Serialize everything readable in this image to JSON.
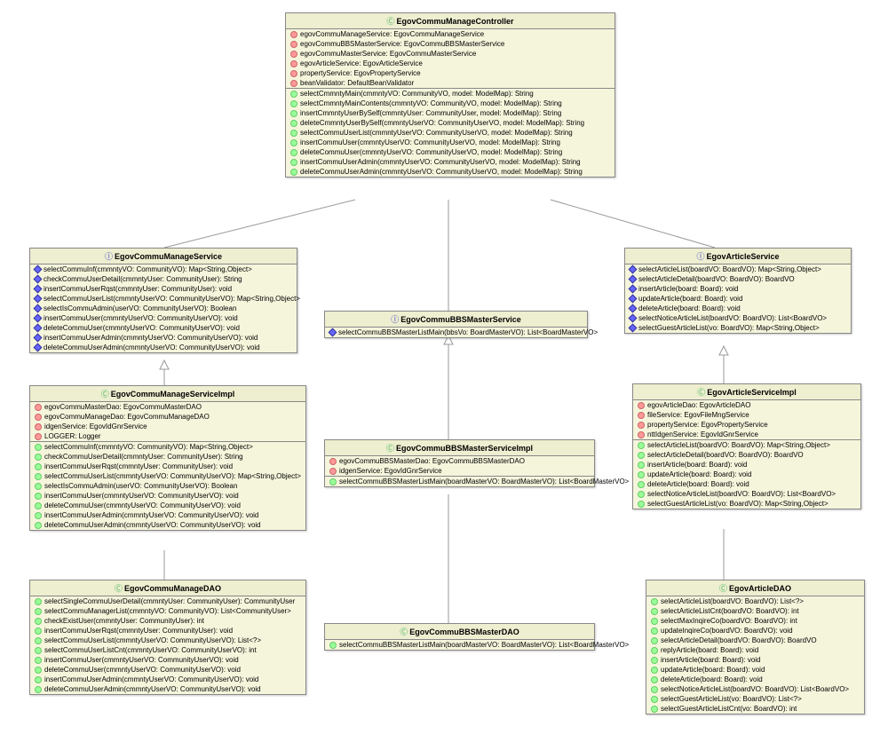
{
  "classes": {
    "controller": {
      "name": "EgovCommuManageController",
      "type": "C",
      "attrs": [
        "egovCommuManageService: EgovCommuManageService",
        "egovCommuBBSMasterService: EgovCommuBBSMasterService",
        "egovCommuMasterService: EgovCommuMasterService",
        "egovArticleService: EgovArticleService",
        "propertyService: EgovPropertyService",
        "beanValidator: DefaultBeanValidator"
      ],
      "methods": [
        "selectCmmntyMain(cmmntyVO: CommunityVO, model: ModelMap): String",
        "selectCmmntyMainContents(cmmntyVO: CommunityVO, model: ModelMap): String",
        "insertCmmntyUserBySelf(cmmntyUser: CommunityUser, model: ModelMap): String",
        "deleteCmmntyUserBySelf(cmmntyUserVO: CommunityUserVO, model: ModelMap): String",
        "selectCommuUserList(cmmntyUserVO: CommunityUserVO, model: ModelMap): String",
        "insertCommuUser(cmmntyUserVO: CommunityUserVO, model: ModelMap): String",
        "deleteCommuUser(cmmntyUserVO: CommunityUserVO, model: ModelMap): String",
        "insertCommuUserAdmin(cmmntyUserVO: CommunityUserVO, model: ModelMap): String",
        "deleteCommuUserAdmin(cmmntyUserVO: CommunityUserVO, model: ModelMap): String"
      ]
    },
    "manageService": {
      "name": "EgovCommuManageService",
      "type": "I",
      "methods": [
        "selectCommuInf(cmmntyVO: CommunityVO): Map<String,Object>",
        "checkCommuUserDetail(cmmntyUser: CommunityUser): String",
        "insertCommuUserRqst(cmmntyUser: CommunityUser): void",
        "selectCommuUserList(cmmntyUserVO: CommunityUserVO): Map<String,Object>",
        "selectIsCommuAdmin(userVO: CommunityUserVO): Boolean",
        "insertCommuUser(cmmntyUserVO: CommunityUserVO): void",
        "deleteCommuUser(cmmntyUserVO: CommunityUserVO): void",
        "insertCommuUserAdmin(cmmntyUserVO: CommunityUserVO): void",
        "deleteCommuUserAdmin(cmmntyUserVO: CommunityUserVO): void"
      ]
    },
    "bbsService": {
      "name": "EgovCommuBBSMasterService",
      "type": "I",
      "methods": [
        "selectCommuBBSMasterListMain(bbsVo: BoardMasterVO): List<BoardMasterVO>"
      ]
    },
    "articleService": {
      "name": "EgovArticleService",
      "type": "I",
      "methods": [
        "selectArticleList(boardVO: BoardVO): Map<String,Object>",
        "selectArticleDetail(boardVO: BoardVO): BoardVO",
        "insertArticle(board: Board): void",
        "updateArticle(board: Board): void",
        "deleteArticle(board: Board): void",
        "selectNoticeArticleList(boardVO: BoardVO): List<BoardVO>",
        "selectGuestArticleList(vo: BoardVO): Map<String,Object>"
      ]
    },
    "manageImpl": {
      "name": "EgovCommuManageServiceImpl",
      "type": "C",
      "attrs": [
        "egovCommuMasterDao: EgovCommuMasterDAO",
        "egovCommuManageDao: EgovCommuManageDAO",
        "idgenService: EgovIdGnrService",
        "LOGGER: Logger"
      ],
      "methods": [
        "selectCommuInf(cmmntyVO: CommunityVO): Map<String,Object>",
        "checkCommuUserDetail(cmmntyUser: CommunityUser): String",
        "insertCommuUserRqst(cmmntyUser: CommunityUser): void",
        "selectCommuUserList(cmmntyUserVO: CommunityUserVO): Map<String,Object>",
        "selectIsCommuAdmin(userVO: CommunityUserVO): Boolean",
        "insertCommuUser(cmmntyUserVO: CommunityUserVO): void",
        "deleteCommuUser(cmmntyUserVO: CommunityUserVO): void",
        "insertCommuUserAdmin(cmmntyUserVO: CommunityUserVO): void",
        "deleteCommuUserAdmin(cmmntyUserVO: CommunityUserVO): void"
      ]
    },
    "bbsImpl": {
      "name": "EgovCommuBBSMasterServiceImpl",
      "type": "C",
      "attrs": [
        "egovCommuBBSMasterDao: EgovCommuBBSMasterDAO",
        "idgenService: EgovIdGnrService"
      ],
      "methods": [
        "selectCommuBBSMasterListMain(boardMasterVO: BoardMasterVO): List<BoardMasterVO>"
      ]
    },
    "articleImpl": {
      "name": "EgovArticleServiceImpl",
      "type": "C",
      "attrs": [
        "egovArticleDao: EgovArticleDAO",
        "fileService: EgovFileMngService",
        "propertyService: EgovPropertyService",
        "nttIdgenService: EgovIdGnrService"
      ],
      "methods": [
        "selectArticleList(boardVO: BoardVO): Map<String,Object>",
        "selectArticleDetail(boardVO: BoardVO): BoardVO",
        "insertArticle(board: Board): void",
        "updateArticle(board: Board): void",
        "deleteArticle(board: Board): void",
        "selectNoticeArticleList(boardVO: BoardVO): List<BoardVO>",
        "selectGuestArticleList(vo: BoardVO): Map<String,Object>"
      ]
    },
    "manageDao": {
      "name": "EgovCommuManageDAO",
      "type": "C",
      "methods": [
        "selectSingleCommuUserDetail(cmmntyUser: CommunityUser): CommunityUser",
        "selectCommuManagerList(cmmntyVO: CommunityVO): List<CommunityUser>",
        "checkExistUser(cmmntyUser: CommunityUser): int",
        "insertCommuUserRqst(cmmntyUser: CommunityUser): void",
        "selectCommuUserList(cmmntyUserVO: CommunityUserVO): List<?>",
        "selectCommuUserListCnt(cmmntyUserVO: CommunityUserVO): int",
        "insertCommuUser(cmmntyUserVO: CommunityUserVO): void",
        "deleteCommuUser(cmmntyUserVO: CommunityUserVO): void",
        "insertCommuUserAdmin(cmmntyUserVO: CommunityUserVO): void",
        "deleteCommuUserAdmin(cmmntyUserVO: CommunityUserVO): void"
      ]
    },
    "bbsDao": {
      "name": "EgovCommuBBSMasterDAO",
      "type": "C",
      "methods": [
        "selectCommuBBSMasterListMain(boardMasterVO: BoardMasterVO): List<BoardMasterVO>"
      ]
    },
    "articleDao": {
      "name": "EgovArticleDAO",
      "type": "C",
      "methods": [
        "selectArticleList(boardVO: BoardVO): List<?>",
        "selectArticleListCnt(boardVO: BoardVO): int",
        "selectMaxInqireCo(boardVO: BoardVO): int",
        "updateInqireCo(boardVO: BoardVO): void",
        "selectArticleDetail(boardVO: BoardVO): BoardVO",
        "replyArticle(board: Board): void",
        "insertArticle(board: Board): void",
        "updateArticle(board: Board): void",
        "deleteArticle(board: Board): void",
        "selectNoticeArticleList(boardVO: BoardVO): List<BoardVO>",
        "selectGuestArticleList(vo: BoardVO): List<?>",
        "selectGuestArticleListCnt(vo: BoardVO): int"
      ]
    }
  }
}
